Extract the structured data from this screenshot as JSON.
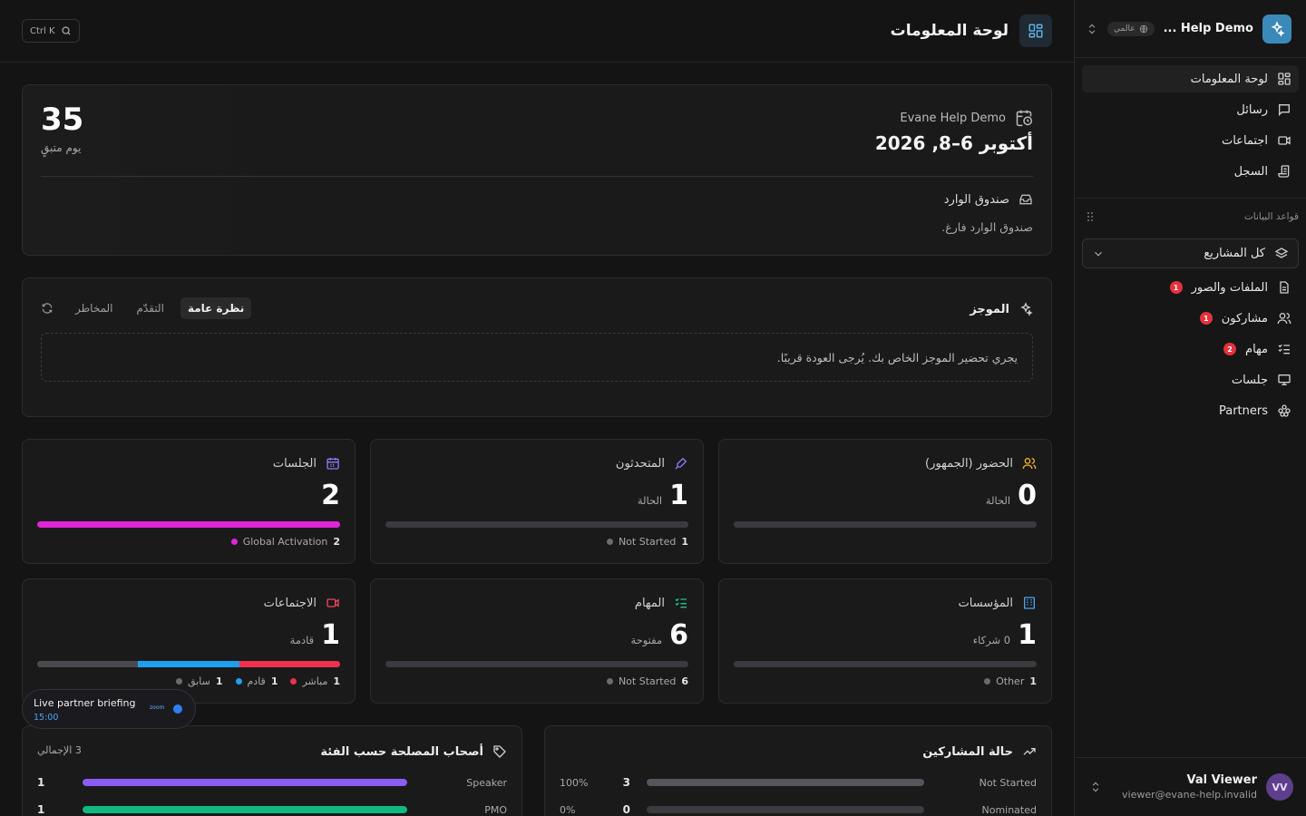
{
  "workspace": {
    "name": "Help Demo ...",
    "badge": "عالمي"
  },
  "nav": [
    {
      "label": "لوحة المعلومات",
      "icon": "dashboard-icon",
      "active": true
    },
    {
      "label": "رسائل",
      "icon": "message-icon"
    },
    {
      "label": "اجتماعات",
      "icon": "video-icon"
    },
    {
      "label": "السجل",
      "icon": "log-icon"
    }
  ],
  "databases": {
    "label": "قواعد البيانات",
    "project_select": "كل المشاريع",
    "items": [
      {
        "label": "الملفات والصور",
        "icon": "file-icon",
        "badge": "1"
      },
      {
        "label": "مشاركون",
        "icon": "users-icon",
        "badge": "1"
      },
      {
        "label": "مهام",
        "icon": "tasks-icon",
        "badge": "2"
      },
      {
        "label": "جلسات",
        "icon": "presentation-icon"
      },
      {
        "label": "Partners",
        "icon": "partners-icon"
      }
    ]
  },
  "user": {
    "initials": "VV",
    "name": "Val Viewer",
    "email": "viewer@evane-help.invalid"
  },
  "header": {
    "title": "لوحة المعلومات",
    "search_shortcut": "Ctrl K"
  },
  "hero": {
    "event_name": "Evane Help Demo",
    "dates": "أكتوبر 6–8, 2026",
    "days_left": "35",
    "days_left_label": "يوم متبقٍ",
    "inbox_title": "صندوق الوارد",
    "inbox_empty": "صندوق الوارد فارغ."
  },
  "brief": {
    "title": "الموجز",
    "tabs": [
      "نظرة عامة",
      "التقدّم",
      "المخاطر"
    ],
    "message": "يجري تحضير الموجز الخاص بك. يُرجى العودة قريبًا."
  },
  "stats": {
    "attendance": {
      "title": "الحضور (الجمهور)",
      "value": "0",
      "sub": "الحالة",
      "color": "#f0b429",
      "segments": [],
      "legend": []
    },
    "speakers": {
      "title": "المتحدثون",
      "value": "1",
      "sub": "الحالة",
      "color": "#8b7cf6",
      "segments": [
        {
          "frac": 1,
          "color": "#3b3b3f"
        }
      ],
      "legend": [
        {
          "count": "1",
          "label": "Not Started",
          "color": "#6b6b70"
        }
      ]
    },
    "sessions": {
      "title": "الجلسات",
      "value": "2",
      "sub": "",
      "color": "#8b7cf6",
      "segments": [
        {
          "frac": 1,
          "color": "#e026d9"
        }
      ],
      "legend": [
        {
          "count": "2",
          "label": "Global Activation",
          "color": "#e026d9"
        }
      ]
    },
    "organizations": {
      "title": "المؤسسات",
      "value": "1",
      "sub": "0 شركاء",
      "color": "#4aa3f0",
      "segments": [
        {
          "frac": 1,
          "color": "#3b3b3f"
        }
      ],
      "legend": [
        {
          "count": "1",
          "label": "Other",
          "color": "#6b6b70"
        }
      ]
    },
    "tasks": {
      "title": "المهام",
      "value": "6",
      "sub": "مفتوحة",
      "color": "#22c58b",
      "segments": [
        {
          "frac": 1,
          "color": "#3b3b3f"
        }
      ],
      "legend": [
        {
          "count": "6",
          "label": "Not Started",
          "color": "#6b6b70"
        }
      ]
    },
    "meetings": {
      "title": "الاجتماعات",
      "value": "1",
      "sub": "قادمة",
      "color": "#f0485c",
      "segments": [
        {
          "frac": 0.333,
          "color": "#4a4a50"
        },
        {
          "frac": 0.334,
          "color": "#1ea0f0"
        },
        {
          "frac": 0.333,
          "color": "#f0304e"
        }
      ],
      "legend": [
        {
          "count": "1",
          "label": "مباشر",
          "color": "#f0304e"
        },
        {
          "count": "1",
          "label": "قادم",
          "color": "#1ea0f0"
        },
        {
          "count": "1",
          "label": "سابق",
          "color": "#6b6b70"
        }
      ]
    }
  },
  "stakeholders": {
    "title": "أصحاب المصلحة حسب الفئة",
    "total": "3 الإجمالي",
    "rows": [
      {
        "label": "Speaker",
        "count": "1",
        "frac": 1,
        "color": "#8b5cf6"
      },
      {
        "label": "PMO",
        "count": "1",
        "frac": 1,
        "color": "#10b981"
      }
    ]
  },
  "participants": {
    "title": "حالة المشاركين",
    "rows": [
      {
        "label": "Not Started",
        "count": "3",
        "pct": "100%",
        "frac": 1,
        "color": "#55555c"
      },
      {
        "label": "Nominated",
        "count": "0",
        "pct": "0%",
        "frac": 0,
        "color": "#55555c"
      }
    ]
  },
  "toast": {
    "title": "Live partner briefing",
    "time": "15:00",
    "provider": "zoom"
  }
}
